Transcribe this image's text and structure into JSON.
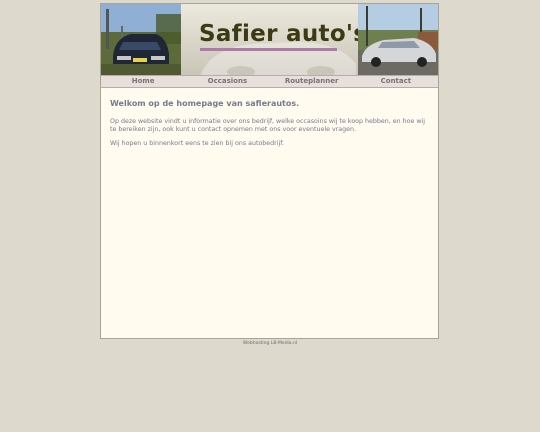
{
  "header": {
    "title": "Safier auto's",
    "photo_left": "car-photo-dark-sedan",
    "photo_right": "car-photo-silver-sedan"
  },
  "nav": {
    "items": [
      {
        "label": "Home"
      },
      {
        "label": "Occasions"
      },
      {
        "label": "Routeplanner"
      },
      {
        "label": "Contact"
      }
    ]
  },
  "main": {
    "heading": "Welkom op de homepage van safierautos.",
    "paragraph_1": "Op deze website vindt u informatie over ons bedrijf, welke occasoins wij te koop hebben, en hoe wij te bereiken zijn, ook kunt u contact opnemen met ons voor eventuele vragen.",
    "paragraph_2": "Wij hopen u binnenkort eens te zien bij ons autobedrijf."
  },
  "footer": {
    "text": "Webhosting LB-Media.nl"
  },
  "colors": {
    "page_background": "#ddd9cc",
    "content_background": "#fffbee",
    "nav_background": "#e7dfd9",
    "title_color": "#3b3a12",
    "title_underline": "#b07aa8",
    "text_color": "#777a8c"
  }
}
